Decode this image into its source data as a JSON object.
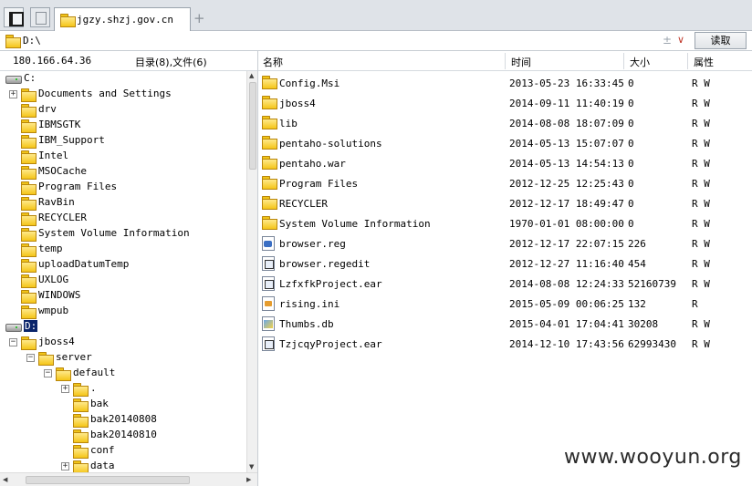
{
  "tabs": {
    "active_title": "jgzy.shzj.gov.cn",
    "add_label": "+"
  },
  "address": {
    "value": "D:\\",
    "plusminus": "±",
    "chevron": "∨",
    "read_button": "读取"
  },
  "left": {
    "ip": "180.166.64.36",
    "counts": "目录(8),文件(6)",
    "tree": [
      {
        "label": "C:",
        "type": "drive",
        "depth": 0,
        "expander": ""
      },
      {
        "label": "Documents and Settings",
        "type": "folder",
        "depth": 0,
        "expander": "+"
      },
      {
        "label": "drv",
        "type": "folder",
        "depth": 0,
        "expander": ""
      },
      {
        "label": "IBMSGTK",
        "type": "folder",
        "depth": 0,
        "expander": ""
      },
      {
        "label": "IBM_Support",
        "type": "folder",
        "depth": 0,
        "expander": ""
      },
      {
        "label": "Intel",
        "type": "folder",
        "depth": 0,
        "expander": ""
      },
      {
        "label": "MSOCache",
        "type": "folder",
        "depth": 0,
        "expander": ""
      },
      {
        "label": "Program Files",
        "type": "folder",
        "depth": 0,
        "expander": ""
      },
      {
        "label": "RavBin",
        "type": "folder",
        "depth": 0,
        "expander": ""
      },
      {
        "label": "RECYCLER",
        "type": "folder",
        "depth": 0,
        "expander": ""
      },
      {
        "label": "System Volume Information",
        "type": "folder",
        "depth": 0,
        "expander": ""
      },
      {
        "label": "temp",
        "type": "folder",
        "depth": 0,
        "expander": ""
      },
      {
        "label": "uploadDatumTemp",
        "type": "folder",
        "depth": 0,
        "expander": ""
      },
      {
        "label": "UXLOG",
        "type": "folder",
        "depth": 0,
        "expander": ""
      },
      {
        "label": "WINDOWS",
        "type": "folder",
        "depth": 0,
        "expander": ""
      },
      {
        "label": "wmpub",
        "type": "folder",
        "depth": 0,
        "expander": ""
      },
      {
        "label": "D:",
        "type": "drive",
        "depth": 0,
        "expander": "",
        "selected": true
      },
      {
        "label": "jboss4",
        "type": "folder",
        "depth": 0,
        "expander": "−"
      },
      {
        "label": "server",
        "type": "folder",
        "depth": 1,
        "expander": "−"
      },
      {
        "label": "default",
        "type": "folder",
        "depth": 2,
        "expander": "−"
      },
      {
        "label": ".",
        "type": "folder",
        "depth": 3,
        "expander": "+"
      },
      {
        "label": "bak",
        "type": "folder",
        "depth": 3,
        "expander": ""
      },
      {
        "label": "bak20140808",
        "type": "folder",
        "depth": 3,
        "expander": ""
      },
      {
        "label": "bak20140810",
        "type": "folder",
        "depth": 3,
        "expander": ""
      },
      {
        "label": "conf",
        "type": "folder",
        "depth": 3,
        "expander": ""
      },
      {
        "label": "data",
        "type": "folder",
        "depth": 3,
        "expander": "+"
      }
    ]
  },
  "list": {
    "headers": {
      "name": "名称",
      "time": "时间",
      "size": "大小",
      "attr": "属性"
    },
    "rows": [
      {
        "name": "Config.Msi",
        "time": "2013-05-23 16:33:45",
        "size": "0",
        "attr": "R W",
        "icon": "folder"
      },
      {
        "name": "jboss4",
        "time": "2014-09-11 11:40:19",
        "size": "0",
        "attr": "R W",
        "icon": "folder"
      },
      {
        "name": "lib",
        "time": "2014-08-08 18:07:09",
        "size": "0",
        "attr": "R W",
        "icon": "folder"
      },
      {
        "name": "pentaho-solutions",
        "time": "2014-05-13 15:07:07",
        "size": "0",
        "attr": "R W",
        "icon": "folder"
      },
      {
        "name": "pentaho.war",
        "time": "2014-05-13 14:54:13",
        "size": "0",
        "attr": "R W",
        "icon": "folder"
      },
      {
        "name": "Program Files",
        "time": "2012-12-25 12:25:43",
        "size": "0",
        "attr": "R W",
        "icon": "folder"
      },
      {
        "name": "RECYCLER",
        "time": "2012-12-17 18:49:47",
        "size": "0",
        "attr": "R W",
        "icon": "folder"
      },
      {
        "name": "System Volume Information",
        "time": "1970-01-01 08:00:00",
        "size": "0",
        "attr": "R W",
        "icon": "folder"
      },
      {
        "name": "browser.reg",
        "time": "2012-12-17 22:07:15",
        "size": "226",
        "attr": "R W",
        "icon": "reg"
      },
      {
        "name": "browser.regedit",
        "time": "2012-12-27 11:16:40",
        "size": "454",
        "attr": "R W",
        "icon": "ear"
      },
      {
        "name": "LzfxfkProject.ear",
        "time": "2014-08-08 12:24:33",
        "size": "52160739",
        "attr": "R W",
        "icon": "ear"
      },
      {
        "name": "rising.ini",
        "time": "2015-05-09 00:06:25",
        "size": "132",
        "attr": "R",
        "icon": "ini"
      },
      {
        "name": "Thumbs.db",
        "time": "2015-04-01 17:04:41",
        "size": "30208",
        "attr": "R W",
        "icon": "db"
      },
      {
        "name": "TzjcqyProject.ear",
        "time": "2014-12-10 17:43:56",
        "size": "62993430",
        "attr": "R W",
        "icon": "ear"
      }
    ]
  },
  "watermark": "www.wooyun.org",
  "colors": {
    "selection": "#0a246a",
    "folder": "#f5c518",
    "chrome": "#dfe3e8"
  }
}
